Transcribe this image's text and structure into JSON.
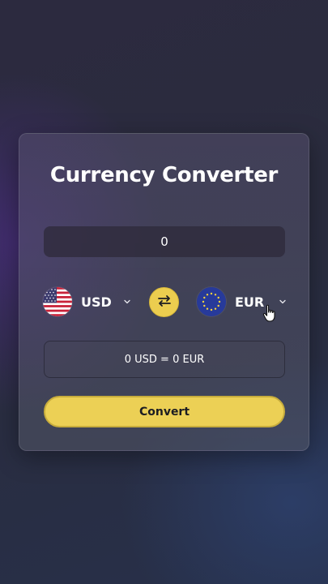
{
  "converter": {
    "title": "Currency Converter",
    "amount": {
      "value": "0"
    },
    "from": {
      "code": "USD",
      "flag": "us-flag-icon"
    },
    "to": {
      "code": "EUR",
      "flag": "eu-flag-icon"
    },
    "swap_icon": "swap-arrows-icon",
    "result": "0 USD = 0 EUR",
    "convert_label": "Convert"
  },
  "colors": {
    "accent": "#ECD055",
    "card": "#4F4D62",
    "text": "#FFFFFF"
  }
}
